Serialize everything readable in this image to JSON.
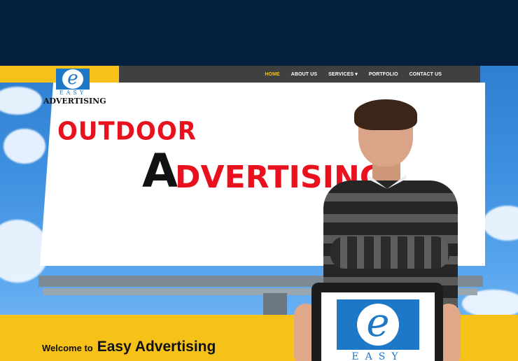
{
  "brand": {
    "logo_letter": "e",
    "logo_sub": "EASY",
    "logo_word": "ADVERTISING"
  },
  "nav": {
    "items": [
      {
        "label": "HOME",
        "active": true
      },
      {
        "label": "ABOUT US",
        "active": false
      },
      {
        "label": "SERVICES ▾",
        "active": false
      },
      {
        "label": "PORTFOLIO",
        "active": false
      },
      {
        "label": "CONTACT US",
        "active": false
      }
    ]
  },
  "hero": {
    "line1": "OUTDOOR",
    "line2_cap": "A",
    "line2_rest": "DVERTISING"
  },
  "welcome": {
    "prefix": "Welcome to",
    "title": "Easy Advertising"
  },
  "tablet": {
    "logo_letter": "e",
    "logo_sub": "EASY"
  },
  "colors": {
    "page_bg": "#03213f",
    "accent_yellow": "#f6c21a",
    "nav_bg": "#404040",
    "headline_red": "#e8121f",
    "logo_blue": "#1e78c8"
  }
}
